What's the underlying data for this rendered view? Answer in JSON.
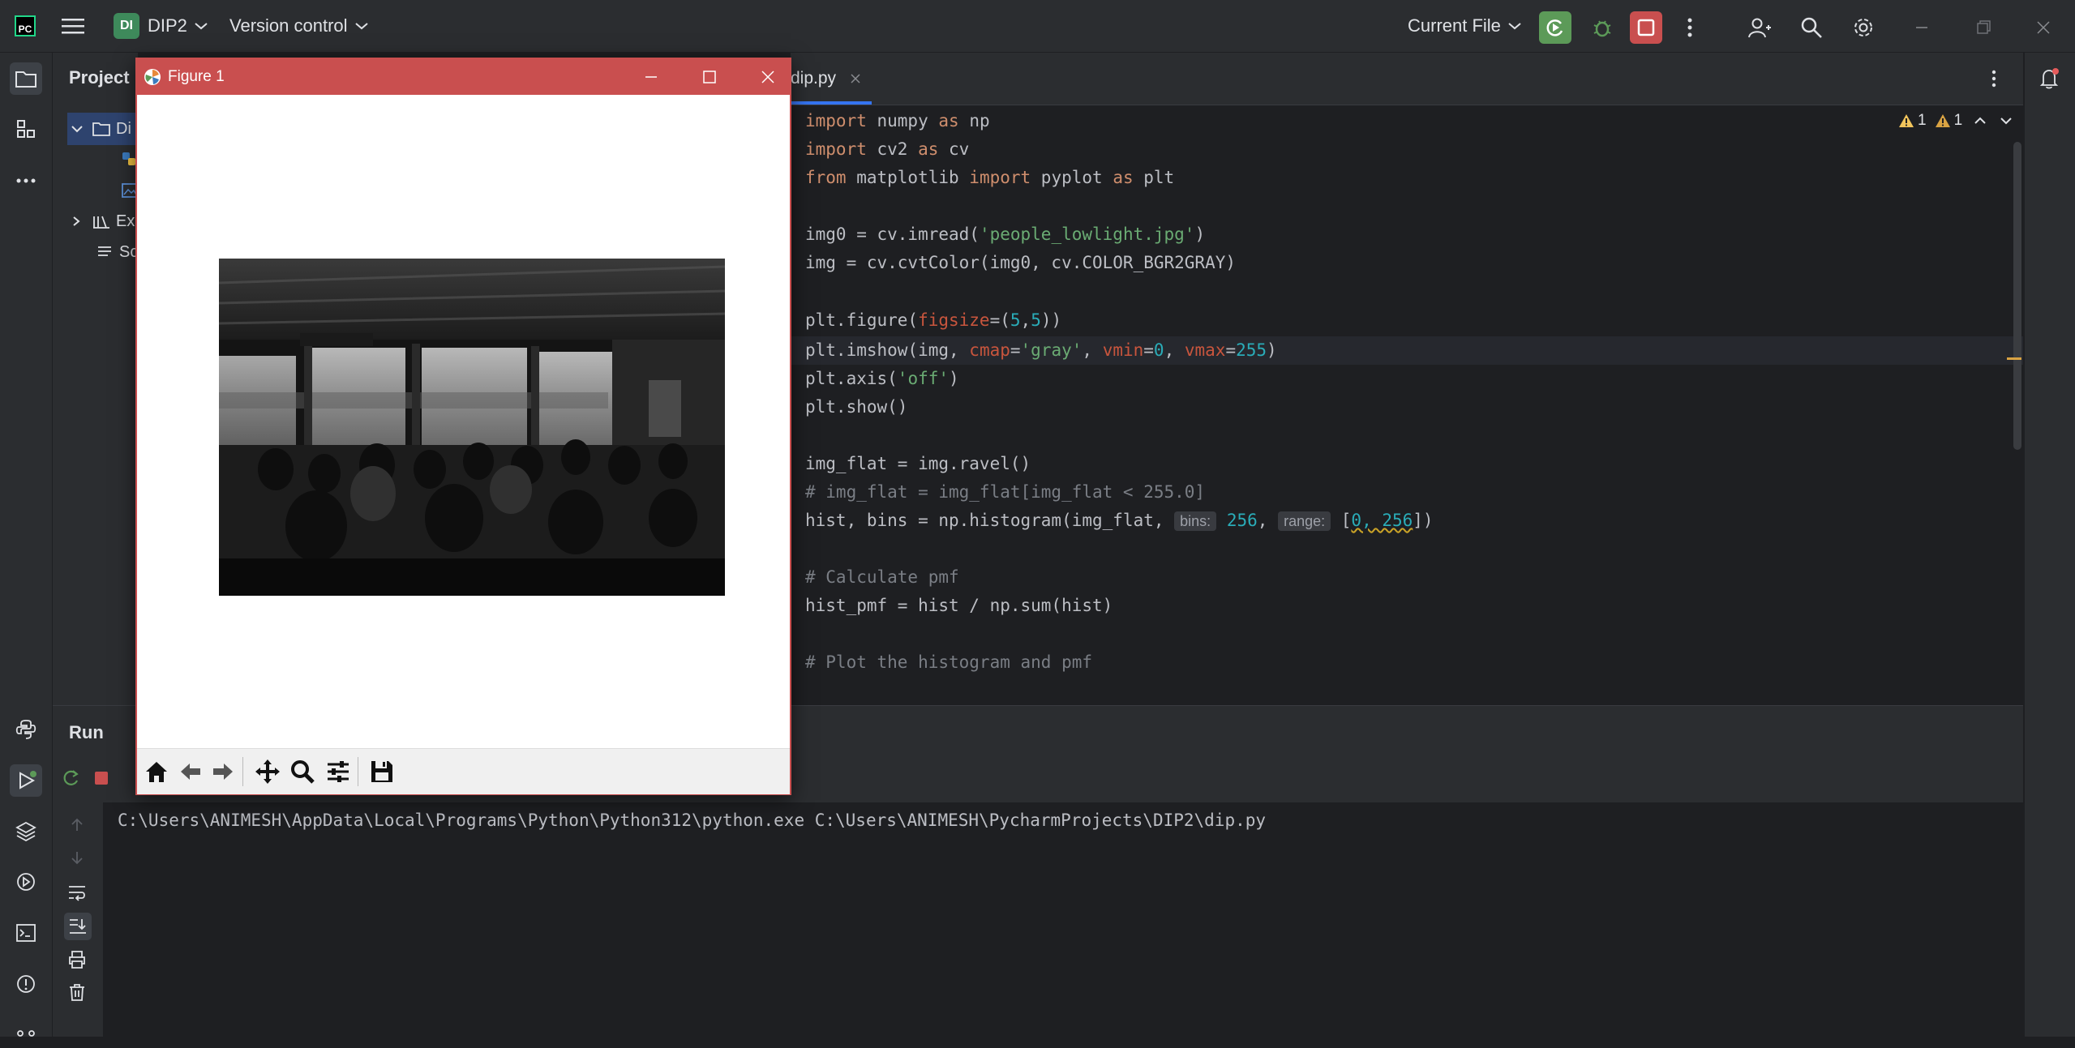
{
  "titlebar": {
    "project_badge": "DI",
    "project_name": "DIP2",
    "vcs_label": "Version control",
    "run_config": "Current File"
  },
  "project_panel": {
    "title": "Project",
    "rows": [
      "Di",
      "",
      "",
      "Ex",
      "Sc"
    ]
  },
  "editor": {
    "tab_name": "dip.py",
    "warnings_a": "1",
    "warnings_b": "1"
  },
  "run_panel": {
    "title": "Run",
    "command": "C:\\Users\\ANIMESH\\AppData\\Local\\Programs\\Python\\Python312\\python.exe C:\\Users\\ANIMESH\\PycharmProjects\\DIP2\\dip.py"
  },
  "figure": {
    "title": "Figure 1"
  },
  "colors": {
    "accent_red": "#c94f4f",
    "run_green": "#5c9a58",
    "bg": "#1e1f22",
    "panel": "#2b2d30"
  }
}
